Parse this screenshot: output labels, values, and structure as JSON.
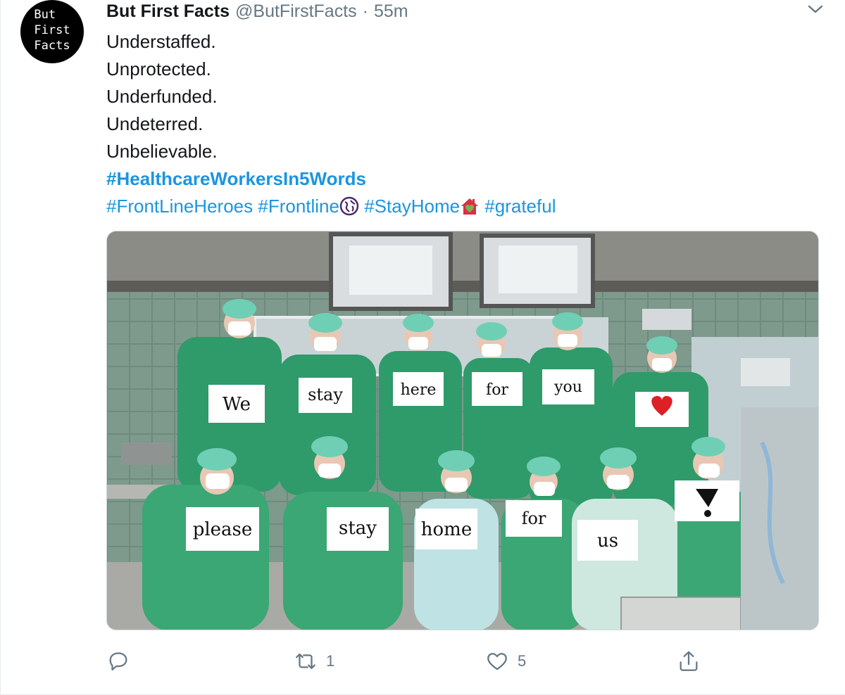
{
  "author": {
    "avatar_text": "But\nFirst\nFacts",
    "display_name": "But First Facts",
    "handle": "@ButFirstFacts",
    "separator": "·",
    "time": "55m"
  },
  "tweet": {
    "lines": [
      "Understaffed.",
      "Unprotected.",
      "Underfunded.",
      "Undeterred.",
      "Unbelievable."
    ],
    "main_hashtag": "#HealthcareWorkersIn5Words",
    "tag_1": "#FrontLineHeroes",
    "tag_2": "#Frontline",
    "tag_3": "#StayHome",
    "tag_4": "#grateful",
    "emoji_1": "globe-emoji",
    "emoji_2": "house-heart-emoji"
  },
  "media": {
    "signs_back": [
      "We",
      "stay",
      "here",
      "for",
      "you"
    ],
    "signs_front": [
      "please",
      "stay",
      "home",
      "for",
      "us"
    ]
  },
  "actions": {
    "reply_count": "",
    "retweet_count": "1",
    "like_count": "5"
  },
  "colors": {
    "link": "#1b95e0",
    "text": "#14171a",
    "muted": "#657786",
    "scrubs": "#2f9a6a"
  }
}
